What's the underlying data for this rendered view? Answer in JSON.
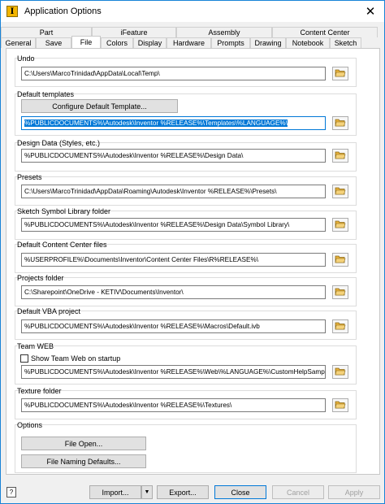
{
  "window": {
    "title": "Application Options",
    "close_glyph": "✕",
    "app_icon_glyph": "I"
  },
  "tabs": {
    "row1": [
      "Part",
      "iFeature",
      "Assembly",
      "Content Center"
    ],
    "row2": [
      "General",
      "Save",
      "File",
      "Colors",
      "Display",
      "Hardware",
      "Prompts",
      "Drawing",
      "Notebook",
      "Sketch"
    ],
    "active": "File"
  },
  "file": {
    "undo": {
      "label": "Undo",
      "value": "C:\\Users\\MarcoTrinidad\\AppData\\Local\\Temp\\"
    },
    "default_templates": {
      "label": "Default templates",
      "configure_button": "Configure Default Template...",
      "value": "%PUBLICDOCUMENTS%\\Autodesk\\Inventor %RELEASE%\\Templates\\%LANGUAGE%\\"
    },
    "design_data": {
      "label": "Design Data (Styles, etc.)",
      "value": "%PUBLICDOCUMENTS%\\Autodesk\\Inventor %RELEASE%\\Design Data\\"
    },
    "presets": {
      "label": "Presets",
      "value": "C:\\Users\\MarcoTrinidad\\AppData\\Roaming\\Autodesk\\Inventor %RELEASE%\\Presets\\"
    },
    "sketch_symbol": {
      "label": "Sketch Symbol Library folder",
      "value": "%PUBLICDOCUMENTS%\\Autodesk\\Inventor %RELEASE%\\Design Data\\Symbol Library\\"
    },
    "content_center": {
      "label": "Default Content Center files",
      "value": "%USERPROFILE%\\Documents\\Inventor\\Content Center Files\\R%RELEASE%\\"
    },
    "projects": {
      "label": "Projects folder",
      "value": "C:\\Sharepoint\\OneDrive - KETIV\\Documents\\Inventor\\"
    },
    "vba": {
      "label": "Default VBA project",
      "value": "%PUBLICDOCUMENTS%\\Autodesk\\Inventor %RELEASE%\\Macros\\Default.ivb"
    },
    "team_web": {
      "label": "Team WEB",
      "checkbox_label": "Show Team Web on startup",
      "checked": false,
      "value": "%PUBLICDOCUMENTS%\\Autodesk\\Inventor %RELEASE%\\Web\\%LANGUAGE%\\CustomHelpSample."
    },
    "texture": {
      "label": "Texture folder",
      "value": "%PUBLICDOCUMENTS%\\Autodesk\\Inventor %RELEASE%\\Textures\\"
    },
    "options": {
      "label": "Options",
      "file_open": "File Open...",
      "file_naming": "File Naming Defaults..."
    }
  },
  "footer": {
    "import": "Import...",
    "export": "Export...",
    "close": "Close",
    "cancel": "Cancel",
    "apply": "Apply",
    "help_glyph": "?",
    "dropdown_glyph": "▼"
  },
  "colors": {
    "accent": "#0078d7",
    "folder_icon": "#e8b13a"
  }
}
